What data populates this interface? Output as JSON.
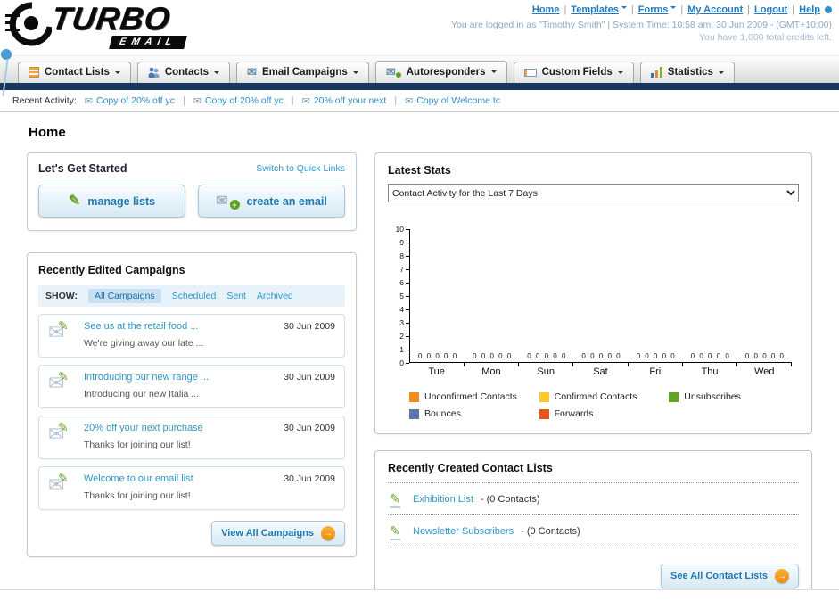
{
  "header": {
    "logo": {
      "title": "TURBO",
      "subtitle": "EMAIL"
    },
    "links": [
      "Home",
      "Templates",
      "Forms",
      "My Account",
      "Logout",
      "Help"
    ],
    "login_info": "You are logged in as \"Timothy Smith\" | System Time: 10:58 am, 30 Jun 2009 - (GMT+10:00)",
    "credits_info": "You have 1,000 total credits left."
  },
  "tabs": [
    {
      "label": "Contact Lists"
    },
    {
      "label": "Contacts"
    },
    {
      "label": "Email Campaigns"
    },
    {
      "label": "Autoresponders"
    },
    {
      "label": "Custom Fields"
    },
    {
      "label": "Statistics"
    }
  ],
  "recent_activity": {
    "label": "Recent Activity:",
    "items": [
      "Copy of 20% off yc",
      "Copy of 20% off yc",
      "20% off your next",
      "Copy of Welcome tc"
    ]
  },
  "page_title": "Home",
  "get_started": {
    "title": "Let's Get Started",
    "switch_link": "Switch to Quick Links",
    "manage_lists_label": "manage lists",
    "create_email_label": "create an email"
  },
  "campaigns": {
    "title": "Recently Edited Campaigns",
    "show_label": "SHOW:",
    "filters": [
      "All Campaigns",
      "Scheduled",
      "Sent",
      "Archived"
    ],
    "active_filter": "All Campaigns",
    "items": [
      {
        "title": "See us at the retail food ...",
        "subtitle": "We're giving away our late ...",
        "date": "30 Jun 2009"
      },
      {
        "title": "Introducing our new range ...",
        "subtitle": "Introducing our new Italia ...",
        "date": "30 Jun 2009"
      },
      {
        "title": "20% off your next purchase",
        "subtitle": "Thanks for joining our list!",
        "date": "30 Jun 2009"
      },
      {
        "title": "Welcome to our email list",
        "subtitle": "Thanks for joining our list!",
        "date": "30 Jun 2009"
      }
    ],
    "view_all_label": "View All Campaigns"
  },
  "stats": {
    "title": "Latest Stats",
    "selected_option": "Contact Activity for the Last 7 Days"
  },
  "chart_data": {
    "type": "bar",
    "title": "Contact Activity for the Last 7 Days",
    "categories": [
      "Tue",
      "Mon",
      "Sun",
      "Sat",
      "Fri",
      "Thu",
      "Wed"
    ],
    "series": [
      {
        "name": "Unconfirmed Contacts",
        "color": "#f28a1e",
        "values": [
          0,
          0,
          0,
          0,
          0,
          0,
          0
        ]
      },
      {
        "name": "Confirmed Contacts",
        "color": "#fdc82f",
        "values": [
          0,
          0,
          0,
          0,
          0,
          0,
          0
        ]
      },
      {
        "name": "Unsubscribes",
        "color": "#61a521",
        "values": [
          0,
          0,
          0,
          0,
          0,
          0,
          0
        ]
      },
      {
        "name": "Bounces",
        "color": "#5b79a6",
        "values": [
          0,
          0,
          0,
          0,
          0,
          0,
          0
        ]
      },
      {
        "name": "Forwards",
        "color": "#e8541e",
        "values": [
          0,
          0,
          0,
          0,
          0,
          0,
          0
        ]
      }
    ],
    "ylim": [
      0,
      10
    ],
    "ytick_step": 1,
    "grid": false,
    "legend_position": "bottom",
    "value_labels_shown": true
  },
  "contact_lists": {
    "title": "Recently Created Contact Lists",
    "items": [
      {
        "name": "Exhibition List",
        "detail": "- (0 Contacts)"
      },
      {
        "name": "Newsletter Subscribers",
        "detail": "- (0 Contacts)"
      }
    ],
    "see_all_label": "See All Contact Lists"
  },
  "icons": {
    "envelope": "✉",
    "pencil": "✎",
    "arrow_right": "→",
    "plus": "+"
  },
  "colors": {
    "accent_blue": "#2f97c9",
    "navy_bar": "#17375e",
    "orange_arrow": "#ef8a0c",
    "link_blue": "#1f7cc0"
  }
}
